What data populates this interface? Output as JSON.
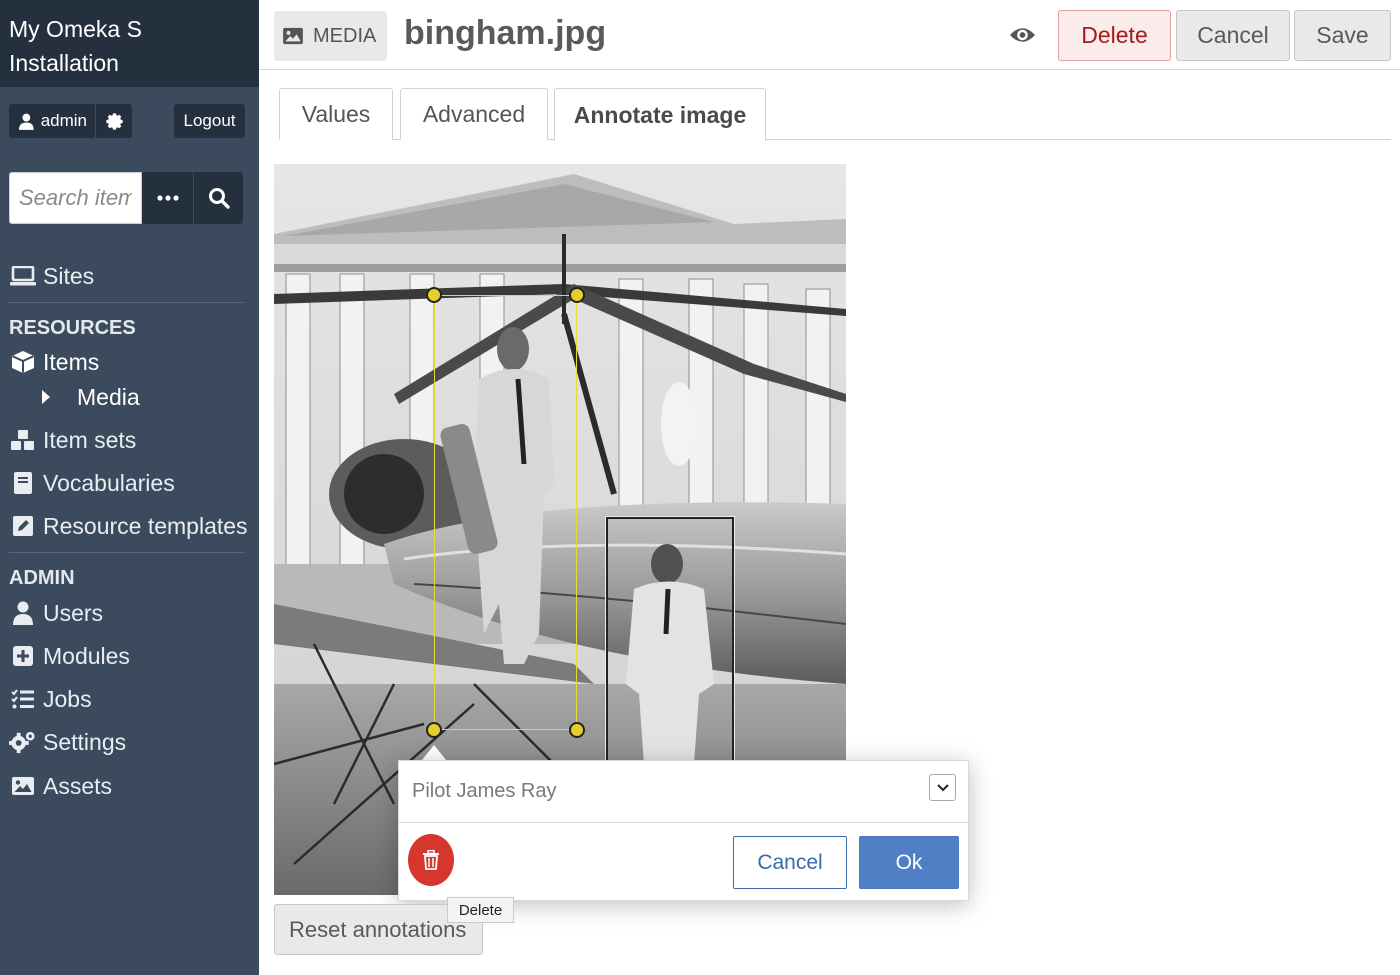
{
  "app": {
    "title": "My Omeka S Installation"
  },
  "user": {
    "name": "admin",
    "logout": "Logout"
  },
  "search": {
    "placeholder": "Search items"
  },
  "nav": {
    "sites": "Sites",
    "resources_heading": "RESOURCES",
    "items": "Items",
    "media": "Media",
    "item_sets": "Item sets",
    "vocabularies": "Vocabularies",
    "resource_templates": "Resource templates",
    "admin_heading": "ADMIN",
    "users": "Users",
    "modules": "Modules",
    "jobs": "Jobs",
    "settings": "Settings",
    "assets": "Assets"
  },
  "header": {
    "badge": "MEDIA",
    "title": "bingham.jpg",
    "delete": "Delete",
    "cancel": "Cancel",
    "save": "Save"
  },
  "tabs": [
    {
      "label": "Values"
    },
    {
      "label": "Advanced"
    },
    {
      "label": "Annotate image",
      "active": true
    }
  ],
  "annotation_editor": {
    "tag_value": "Pilot James Ray",
    "cancel": "Cancel",
    "ok": "Ok",
    "delete_tooltip": "Delete"
  },
  "reset_button": "Reset annotations",
  "colors": {
    "sidebar_bg": "#3c4a5d",
    "sidebar_dark": "#25303e",
    "danger": "#a91919",
    "primary": "#4f7fc4",
    "selection": "#e8d93a"
  }
}
